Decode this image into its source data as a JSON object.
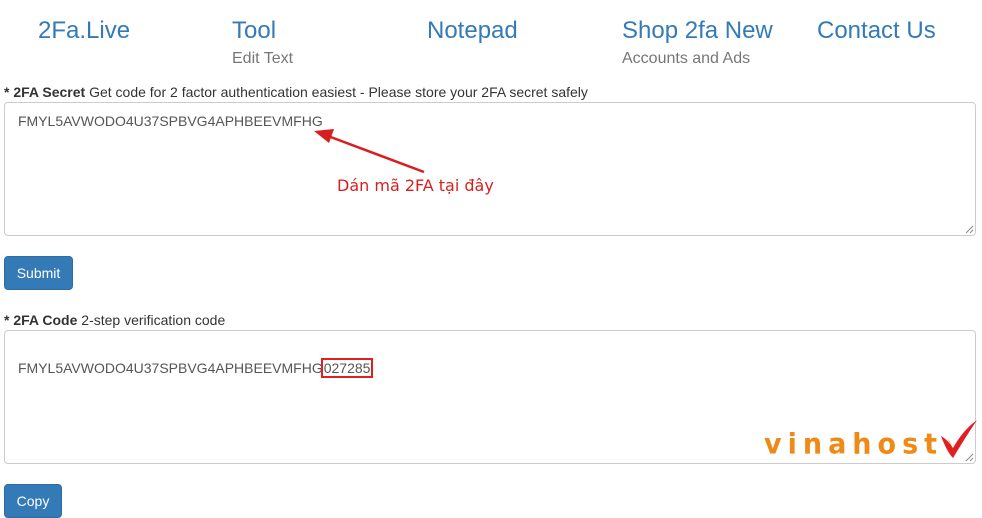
{
  "nav": {
    "brand": "2Fa.Live",
    "tool": {
      "title": "Tool",
      "sub": "Edit Text"
    },
    "notepad": "Notepad",
    "shop": {
      "title": "Shop 2fa New",
      "sub": "Accounts and Ads"
    },
    "contact": "Contact Us"
  },
  "secret": {
    "label_strong": "* 2FA Secret",
    "label_rest": " Get code for 2 factor authentication easiest - Please store your 2FA secret safely",
    "value": "FMYL5AVWODO4U37SPBVG4APHBEEVMFHG"
  },
  "annotation": {
    "text": "Dán mã 2FA tại đây",
    "color": "#d81f1f"
  },
  "submit_label": "Submit",
  "code": {
    "label_strong": "* 2FA Code",
    "label_rest": " 2-step verification code",
    "secret_part": "FMYL5AVWODO4U37SPBVG4APHBEEVMFHG",
    "otp": "027285"
  },
  "copy_label": "Copy",
  "logo": {
    "text": "vinahost",
    "color": "#ef8a16",
    "accent_color": "#e02020"
  },
  "colors": {
    "link": "#337ab7",
    "button": "#337ab7",
    "highlight": "#e02020"
  }
}
